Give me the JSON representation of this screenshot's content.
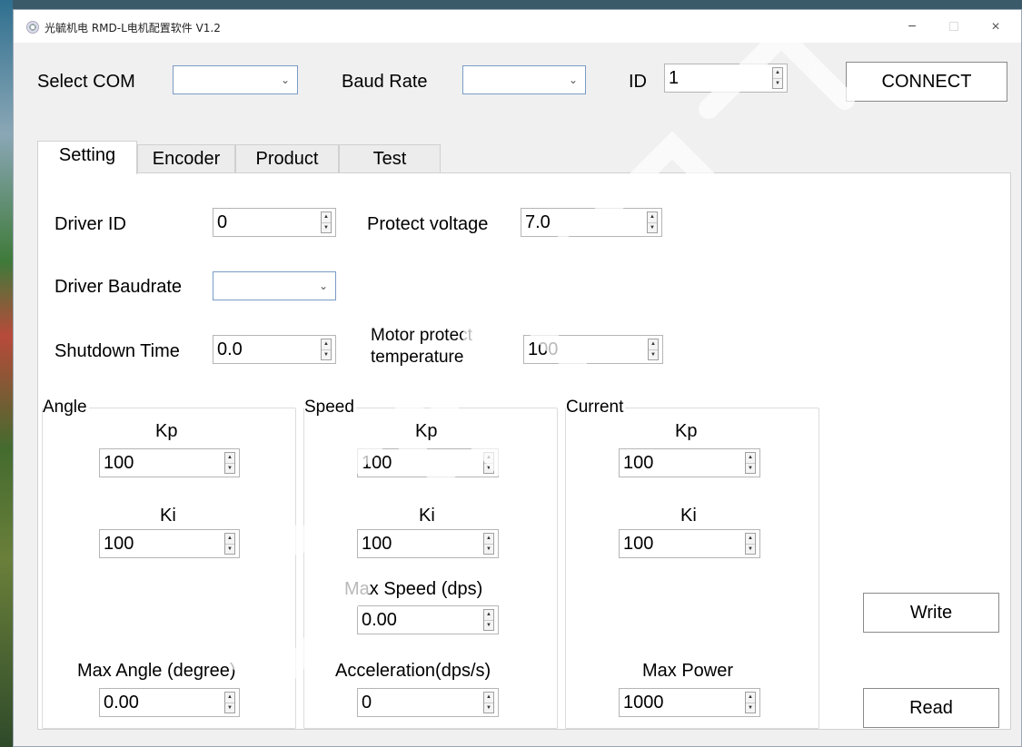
{
  "window": {
    "title": "光毓机电 RMD-L电机配置软件 V1.2",
    "min_glyph": "−",
    "max_glyph": "□",
    "close_glyph": "×"
  },
  "connection": {
    "com_label": "Select COM",
    "com_value": "",
    "baud_label": "Baud Rate",
    "baud_value": "",
    "id_label": "ID",
    "id_value": "1",
    "connect_label": "CONNECT"
  },
  "tabs": [
    {
      "label": "Setting",
      "active": true
    },
    {
      "label": "Encoder",
      "active": false
    },
    {
      "label": "Product",
      "active": false
    },
    {
      "label": "Test",
      "active": false
    }
  ],
  "setting": {
    "driver_id_label": "Driver ID",
    "driver_id_value": "0",
    "protect_voltage_label": "Protect voltage",
    "protect_voltage_value": "7.0",
    "driver_baudrate_label": "Driver Baudrate",
    "driver_baudrate_value": "",
    "shutdown_time_label": "Shutdown Time",
    "shutdown_time_value": "0.0",
    "motor_protect_temp_label_line1": "Motor protect",
    "motor_protect_temp_label_line2": "temperature",
    "motor_protect_temp_value": "100"
  },
  "angle": {
    "title": "Angle",
    "kp_label": "Kp",
    "kp_value": "100",
    "ki_label": "Ki",
    "ki_value": "100",
    "max_label": "Max Angle (degree)",
    "max_value": "0.00"
  },
  "speed": {
    "title": "Speed",
    "kp_label": "Kp",
    "kp_value": "100",
    "ki_label": "Ki",
    "ki_value": "100",
    "max_speed_label": "Max Speed (dps)",
    "max_speed_value": "0.00",
    "accel_label": "Acceleration(dps/s)",
    "accel_value": "0"
  },
  "current": {
    "title": "Current",
    "kp_label": "Kp",
    "kp_value": "100",
    "ki_label": "Ki",
    "ki_value": "100",
    "max_power_label": "Max Power",
    "max_power_value": "1000"
  },
  "actions": {
    "write_label": "Write",
    "read_label": "Read"
  },
  "glyphs": {
    "dropdown": "⌄",
    "spin_up": "▲",
    "spin_down": "▼"
  }
}
